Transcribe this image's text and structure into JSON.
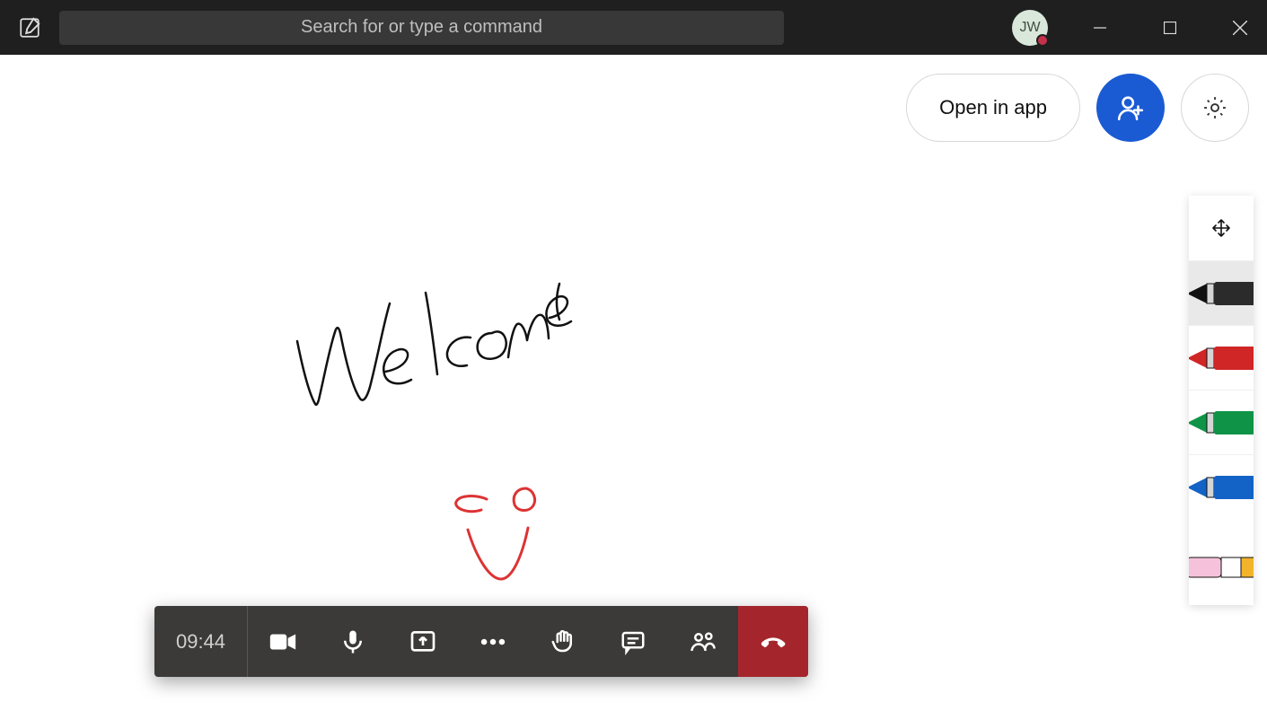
{
  "titlebar": {
    "search_placeholder": "Search for or type a command",
    "avatar_initials": "JW"
  },
  "whiteboard_controls": {
    "open_in_app_label": "Open in app"
  },
  "pen_toolbar": {
    "tools": [
      {
        "name": "move-tool",
        "selected": false
      },
      {
        "name": "black-pen",
        "selected": true
      },
      {
        "name": "red-pen",
        "selected": false
      },
      {
        "name": "green-pen",
        "selected": false
      },
      {
        "name": "blue-pen",
        "selected": false
      },
      {
        "name": "eraser",
        "selected": false
      }
    ]
  },
  "canvas": {
    "handwriting_text": "Welcome"
  },
  "meeting_bar": {
    "elapsed_time": "09:44"
  },
  "colors": {
    "accent_blue": "#1a5bd3",
    "hangup_red": "#a4262c",
    "presence_busy": "#c4314b"
  }
}
